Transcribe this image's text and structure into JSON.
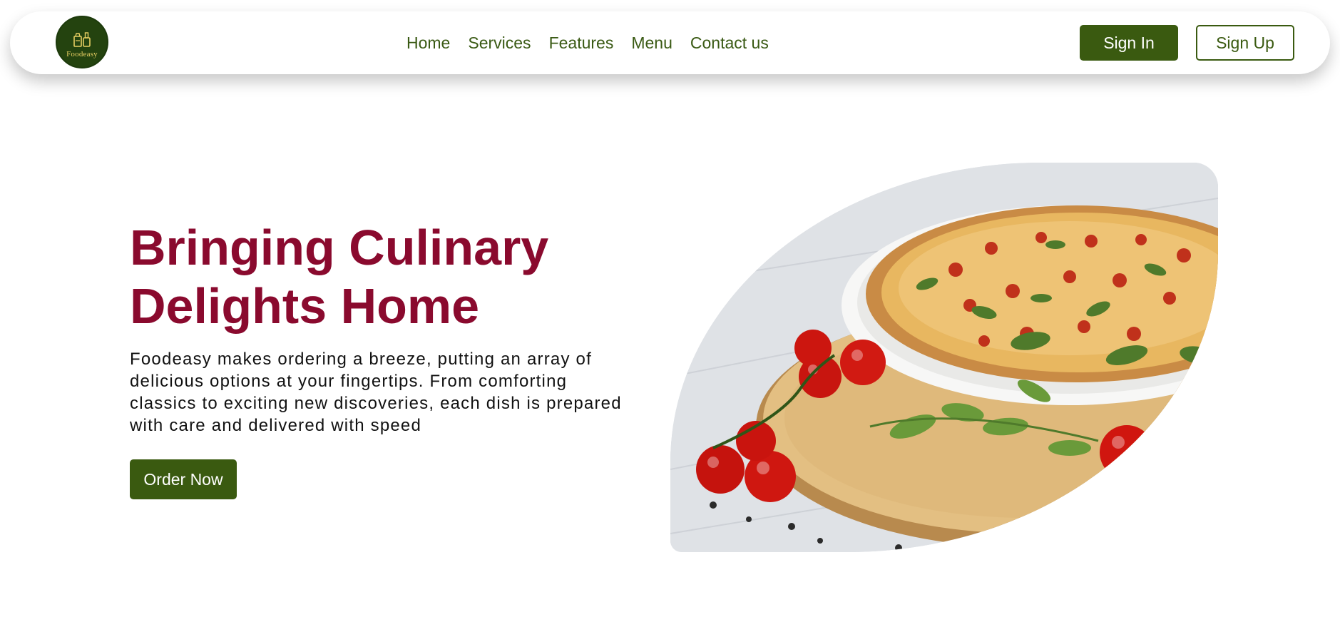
{
  "brand": {
    "logo_text": "Foodeasy",
    "logo_icon": "food-bottles-icon",
    "colors": {
      "primary_green": "#3a5a10",
      "logo_bg": "#24430f",
      "accent_maroon": "#8a0a2e",
      "logo_text": "#e8cf63"
    }
  },
  "nav": {
    "links": [
      "Home",
      "Services",
      "Features",
      "Menu",
      "Contact us"
    ],
    "sign_in": "Sign In",
    "sign_up": "Sign Up"
  },
  "hero": {
    "title": "Bringing Culinary Delights Home",
    "description": "Foodeasy makes ordering a breeze, putting an array of delicious options at your fingertips. From comforting classics to exciting new discoveries, each dish is prepared with care and delivered with speed",
    "cta": "Order Now",
    "image": "pizza-with-tomatoes-and-basil-image"
  }
}
